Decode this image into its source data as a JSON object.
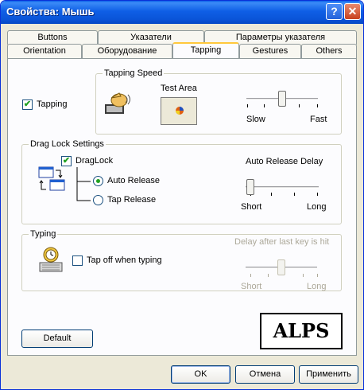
{
  "window": {
    "title": "Свойства: Мышь",
    "help_label": "?",
    "close_label": "✕"
  },
  "tabs_row1": [
    "Buttons",
    "Указатели",
    "Параметры указателя"
  ],
  "tabs_row2": [
    "Orientation",
    "Оборудование",
    "Tapping",
    "Gestures",
    "Others"
  ],
  "active_tab": "Tapping",
  "tapping_speed": {
    "group_label": "Tapping Speed",
    "test_area_label": "Test Area",
    "slow_label": "Slow",
    "fast_label": "Fast",
    "value_fraction": 0.5
  },
  "tapping": {
    "label": "Tapping",
    "checked": true,
    "check_mark": "✔"
  },
  "drag_lock": {
    "group_label": "Drag Lock Settings",
    "draglock_label": "DragLock",
    "draglock_checked": true,
    "auto_release_label": "Auto Release",
    "tap_release_label": "Tap Release",
    "selected": "Auto Release",
    "delay_label": "Auto Release Delay",
    "short_label": "Short",
    "long_label": "Long",
    "delay_fraction": 0.0
  },
  "typing": {
    "group_label": "Typing",
    "tap_off_label": "Tap off when typing",
    "tap_off_checked": false,
    "delay_label": "Delay after last key is hit",
    "short_label": "Short",
    "long_label": "Long",
    "delay_fraction": 0.5
  },
  "buttons": {
    "default_label": "Default",
    "ok_label": "OK",
    "cancel_label": "Отмена",
    "apply_label": "Применить"
  },
  "logo_text": "ALPS",
  "colors": {
    "title_blue": "#0A54D8",
    "face": "#ECE9D8",
    "check_green": "#21A121",
    "tab_highlight": "#FFC83C"
  }
}
